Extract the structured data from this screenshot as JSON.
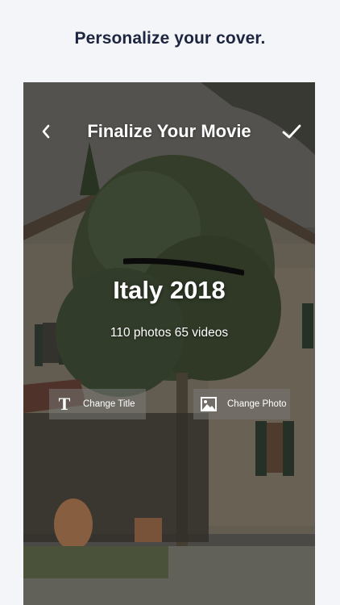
{
  "headline": "Personalize your cover.",
  "nav": {
    "title": "Finalize Your Movie",
    "back_icon": "chevron-left-icon",
    "done_icon": "checkmark-icon"
  },
  "cover": {
    "title": "Italy 2018",
    "subtitle": "110 photos 65 videos"
  },
  "actions": {
    "change_title": "Change Title",
    "change_photo": "Change Photo",
    "change_title_icon": "text-icon",
    "change_photo_icon": "image-icon"
  },
  "colors": {
    "page_bg": "#f4f5f8",
    "headline": "#1d2540",
    "overlay_text": "#ffffff",
    "button_bg": "rgba(120,120,116,0.55)"
  }
}
